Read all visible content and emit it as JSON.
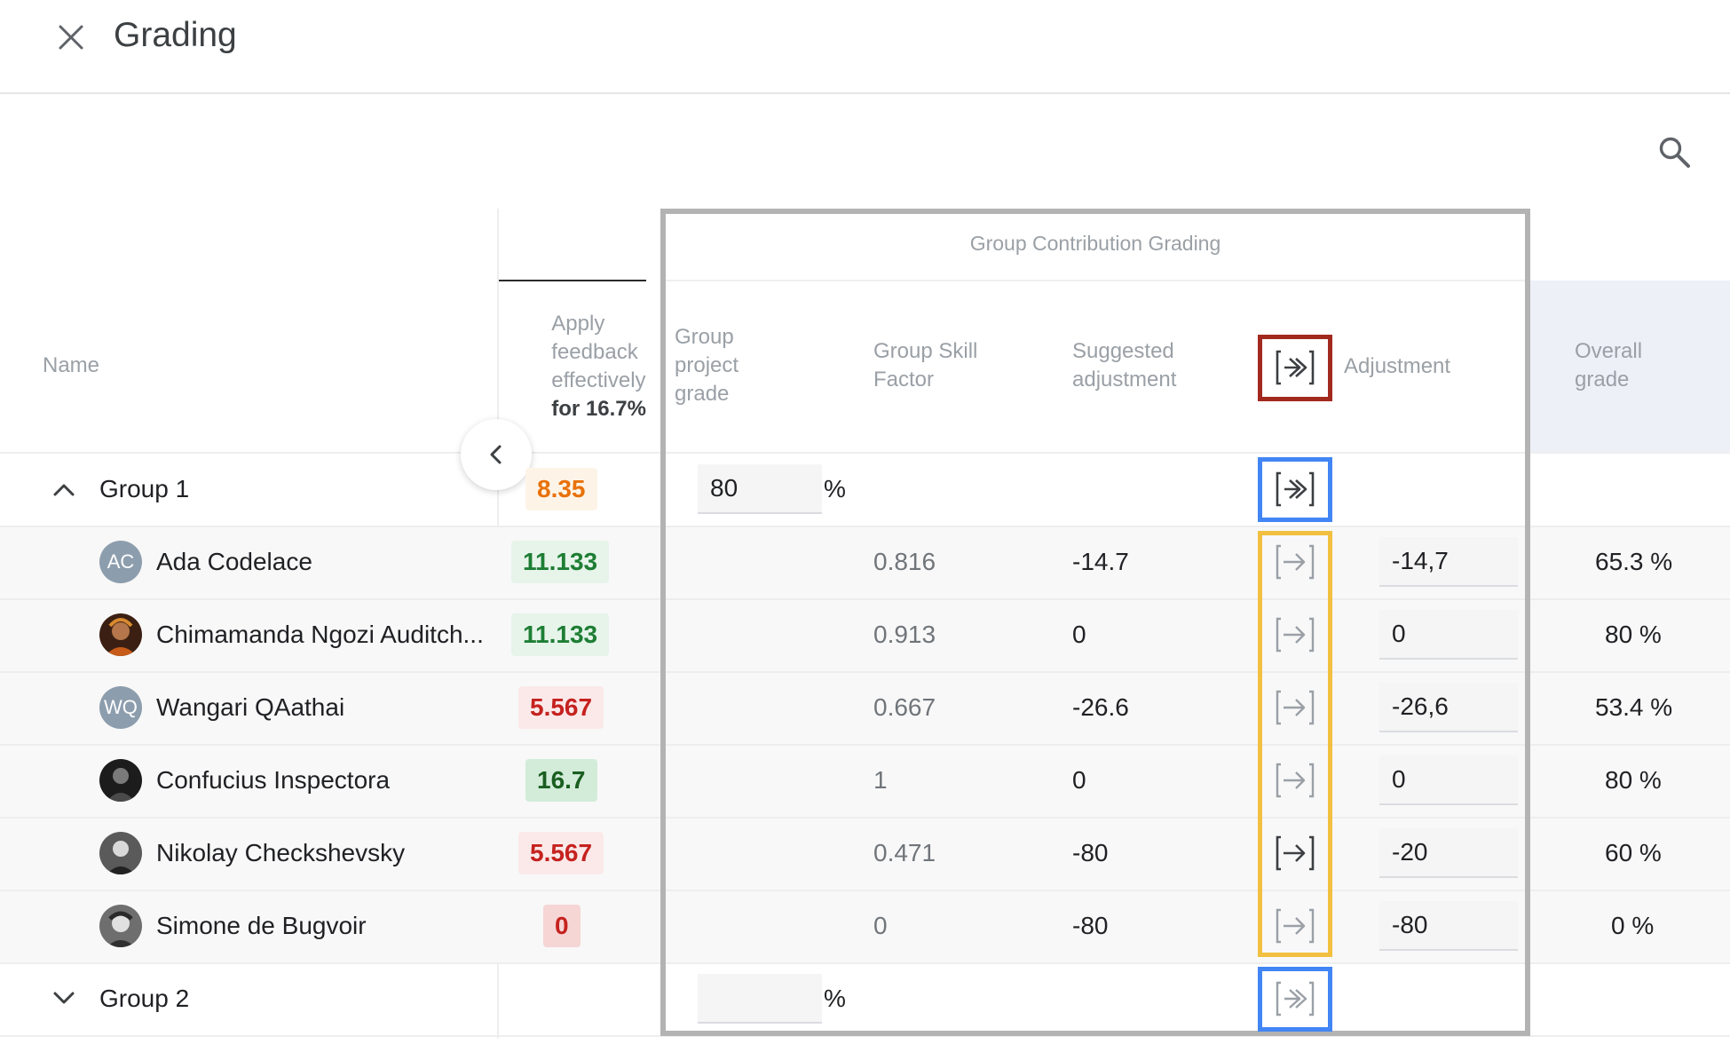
{
  "header": {
    "title": "Grading"
  },
  "table": {
    "columns": {
      "name": "Name",
      "criterion_lines": [
        "Apply",
        "feedback",
        "effectively"
      ],
      "criterion_weight": "for 16.7%",
      "group_project_grade": [
        "Group",
        "project",
        "grade"
      ],
      "group_skill_factor": [
        "Group Skill",
        "Factor"
      ],
      "suggested_adjustment": [
        "Suggested",
        "adjustment"
      ],
      "adjustment": "Adjustment",
      "overall_grade": [
        "Overall",
        "grade"
      ]
    },
    "panel_title": "Group Contribution Grading",
    "percent_symbol": "%",
    "group1": {
      "name": "Group 1",
      "score": "8.35",
      "project_grade": "80",
      "expanded": true
    },
    "group2": {
      "name": "Group 2",
      "score": "",
      "project_grade": "",
      "expanded": false
    },
    "students": [
      {
        "name": "Ada Codelace",
        "initials": "AC",
        "score": "11.133",
        "skill_factor": "0.816",
        "suggested": "-14.7",
        "adjustment": "-14,7",
        "overall": "65.3 %"
      },
      {
        "name": "Chimamanda Ngozi Auditch...",
        "initials": "",
        "score": "11.133",
        "skill_factor": "0.913",
        "suggested": "0",
        "adjustment": "0",
        "overall": "80 %"
      },
      {
        "name": "Wangari QAathai",
        "initials": "WQ",
        "score": "5.567",
        "skill_factor": "0.667",
        "suggested": "-26.6",
        "adjustment": "-26,6",
        "overall": "53.4 %"
      },
      {
        "name": "Confucius Inspectora",
        "initials": "",
        "score": "16.7",
        "skill_factor": "1",
        "suggested": "0",
        "adjustment": "0",
        "overall": "80 %"
      },
      {
        "name": "Nikolay Checkshevsky",
        "initials": "",
        "score": "5.567",
        "skill_factor": "0.471",
        "suggested": "-80",
        "adjustment": "-20",
        "overall": "60 %"
      },
      {
        "name": "Simone de Bugvoir",
        "initials": "",
        "score": "0",
        "skill_factor": "0",
        "suggested": "-80",
        "adjustment": "-80",
        "overall": "0 %"
      }
    ]
  },
  "icons": {
    "close": "close-icon",
    "search": "search-icon",
    "collapse": "chevron-left-icon",
    "expand_up": "chevron-up-icon",
    "expand_down": "chevron-down-icon",
    "apply_all": "apply-all-arrow-icon",
    "apply_one": "apply-arrow-icon"
  },
  "colors": {
    "highlight_red": "#a2291e",
    "highlight_blue": "#4285f4",
    "highlight_yellow": "#f2c040",
    "panel_border": "#b3b3b3",
    "score_green": "#1e7e34",
    "score_red": "#c5221f",
    "score_orange": "#e8710a"
  }
}
